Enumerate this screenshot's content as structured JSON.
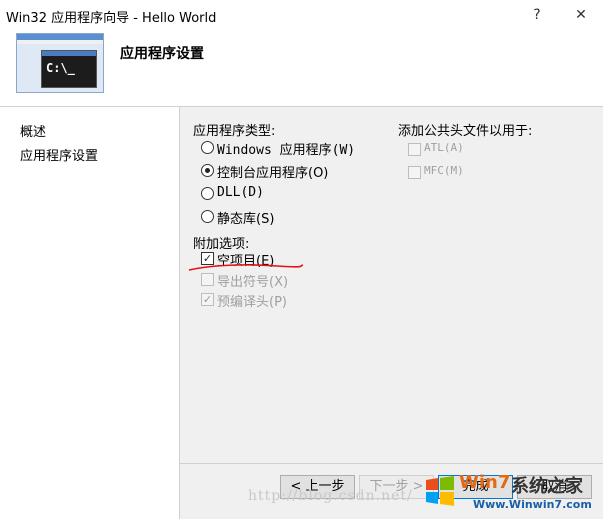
{
  "window": {
    "title": "Win32 应用程序向导 - Hello World",
    "help_label": "?",
    "close_label": "✕"
  },
  "header": {
    "title": "应用程序设置",
    "thumbnail_prompt": "C:\\_"
  },
  "nav": {
    "items": [
      {
        "label": "概述"
      },
      {
        "label": "应用程序设置"
      }
    ]
  },
  "app_type": {
    "label": "应用程序类型:",
    "options": [
      {
        "label": "Windows 应用程序(W)",
        "checked": false
      },
      {
        "label": "控制台应用程序(O)",
        "checked": true
      },
      {
        "label": "DLL(D)",
        "checked": false
      },
      {
        "label": "静态库(S)",
        "checked": false
      }
    ]
  },
  "additional": {
    "label": "附加选项:",
    "options": [
      {
        "label": "空项目(E)",
        "checked": true,
        "enabled": true
      },
      {
        "label": "导出符号(X)",
        "checked": false,
        "enabled": false
      },
      {
        "label": "预编译头(P)",
        "checked": true,
        "enabled": false
      }
    ]
  },
  "common_headers": {
    "label": "添加公共头文件以用于:",
    "options": [
      {
        "label": "ATL(A)",
        "checked": false,
        "enabled": false
      },
      {
        "label": "MFC(M)",
        "checked": false,
        "enabled": false
      }
    ]
  },
  "buttons": {
    "prev": "< 上一步",
    "next": "下一步 >",
    "finish": "完成",
    "cancel": "取消"
  },
  "watermark": {
    "text": "http://blog.csdn.net/"
  },
  "logo": {
    "brand": "Win7",
    "brand_cn": "系统之家",
    "site": "Www.Winwin7.com"
  },
  "colors": {
    "annotation_red": "#e0121a",
    "pane_bg": "#f0f0f0",
    "brand_orange": "#e26a14",
    "site_blue": "#1a5fa6"
  }
}
